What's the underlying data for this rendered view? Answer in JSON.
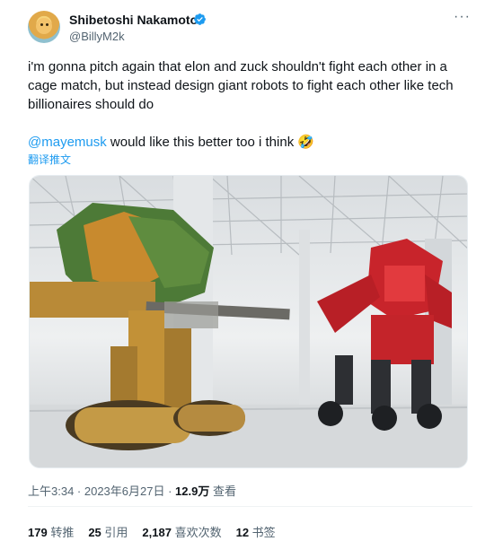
{
  "author": {
    "name": "Shibetoshi Nakamoto",
    "handle": "@BillyM2k"
  },
  "tweet": {
    "text": "i'm gonna pitch again that elon and zuck shouldn't fight each other in a cage match, but instead design giant robots to fight each other like tech billionaires should do",
    "mention": "@mayemusk",
    "text2_rest": " would like this better too i think 🤣",
    "translate_label": "翻译推文"
  },
  "meta": {
    "time": "上午3:34 · 2023年6月27日 · ",
    "views_count": "12.9万",
    "views_label": " 查看"
  },
  "stats": {
    "retweets_count": "179",
    "retweets_label": " 转推",
    "quotes_count": "25",
    "quotes_label": " 引用",
    "likes_count": "2,187",
    "likes_label": " 喜欢次数",
    "bookmarks_count": "12",
    "bookmarks_label": " 书签"
  },
  "colors": {
    "accent": "#1d9bf0",
    "text": "#0f1419",
    "muted": "#536471"
  },
  "icons": [
    "verified-badge-icon",
    "more-options-icon"
  ]
}
